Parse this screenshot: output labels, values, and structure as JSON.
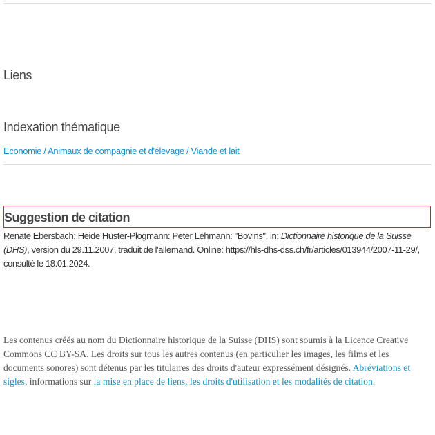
{
  "sections": {
    "liens_title": "Liens",
    "indexation_title": "Indexation thématique"
  },
  "topics": {
    "items": [
      "Economie",
      "Animaux de compagnie et d'élevage",
      "Viande et lait"
    ],
    "separator": "/"
  },
  "citation": {
    "title": "Suggestion de citation",
    "authors": "Renate Ebersbach: Heide Hüster-Plogmann: Peter Lehmann: \"Bovins\", in: ",
    "work": "Dictionnaire historique de la Suisse (DHS)",
    "rest": ", version du 29.11.2007, traduit de l'allemand. Online: https://hls-dhs-dss.ch/fr/articles/013944/2007-11-29/, consulté le 18.01.2024."
  },
  "license": {
    "text_1": "Les contenus créés au nom du Dictionnaire historique de la Suisse (DHS) sont soumis à la Licence Creative Commons CC BY-SA. Les droits sur tous les autres contenus (en particulier les images, les films et les documents sonores) sont détenus par les titulaires des droits d'auteur expressément désignés. ",
    "link_abbrev": "Abréviations et sigles",
    "text_2": ", informations sur ",
    "link_rights": "la mise en place de liens, les droits d'utilisation et les modalités de citation",
    "text_3": "."
  }
}
